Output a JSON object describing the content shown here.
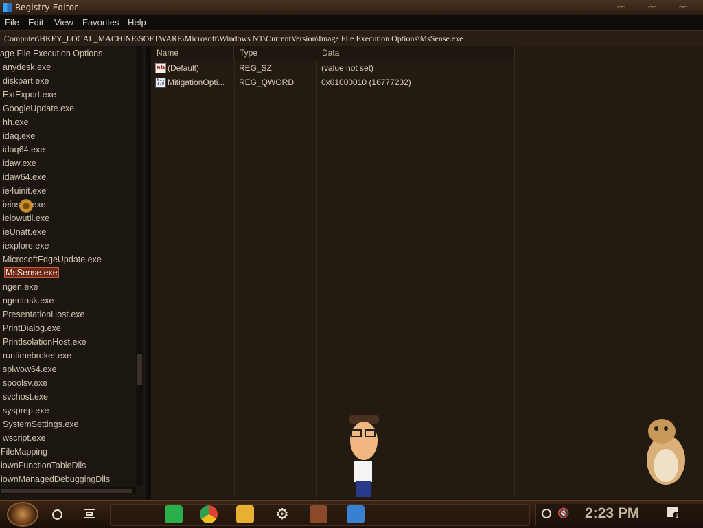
{
  "window": {
    "title": "Registry Editor",
    "controls": [
      "minimize",
      "maximize",
      "close"
    ]
  },
  "menu": [
    "File",
    "Edit",
    "View",
    "Favorites",
    "Help"
  ],
  "address": "Computer\\HKEY_LOCAL_MACHINE\\SOFTWARE\\Microsoft\\Windows NT\\CurrentVersion\\Image File Execution Options\\MsSense.exe",
  "tree": {
    "items": [
      "age File Execution Options",
      "anydesk.exe",
      "diskpart.exe",
      "ExtExport.exe",
      "GoogleUpdate.exe",
      "hh.exe",
      "idaq.exe",
      "idaq64.exe",
      "idaw.exe",
      "idaw64.exe",
      "ie4uinit.exe",
      "ieinstal.exe",
      "ielowutil.exe",
      "ieUnatt.exe",
      "iexplore.exe",
      "MicrosoftEdgeUpdate.exe",
      "MsSense.exe",
      "ngen.exe",
      "ngentask.exe",
      "PresentationHost.exe",
      "PrintDialog.exe",
      "PrintIsolationHost.exe",
      "runtimebroker.exe",
      "splwow64.exe",
      "spoolsv.exe",
      "svchost.exe",
      "sysprep.exe",
      "SystemSettings.exe",
      "wscript.exe",
      "FileMapping",
      "iownFunctionTableDlls",
      "iownManagedDebuggingDlls"
    ],
    "selected": "MsSense.exe"
  },
  "list": {
    "columns": [
      "Name",
      "Type",
      "Data"
    ],
    "rows": [
      {
        "icon": "string-value-icon",
        "name": "(Default)",
        "type": "REG_SZ",
        "data": "(value not set)"
      },
      {
        "icon": "binary-value-icon",
        "name": "MitigationOpti...",
        "type": "REG_QWORD",
        "data": "0x01000010 (16777232)"
      }
    ]
  },
  "taskbar": {
    "clock": "2:23 PM",
    "pinned_icons": [
      "spotify-icon",
      "chrome-icon",
      "file-explorer-icon",
      "settings-icon",
      "app-icon",
      "registry-editor-icon"
    ],
    "tray_icons": [
      "network-icon",
      "volume-muted-icon",
      "notifications-icon"
    ],
    "notification_count": "1"
  },
  "colors": {
    "accent": "#c85a3a",
    "background": "#231a12",
    "text": "#d8cbb8"
  }
}
